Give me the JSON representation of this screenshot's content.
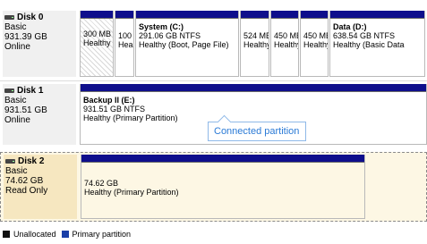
{
  "disks": [
    {
      "name": "Disk 0",
      "type": "Basic",
      "size": "931.39 GB",
      "status": "Online",
      "partitions": [
        {
          "title": "",
          "line1": "300 MB",
          "line2": "Healthy"
        },
        {
          "title": "",
          "line1": "100 MB",
          "line2": "Healthy"
        },
        {
          "title": "System  (C:)",
          "line1": "291.06 GB NTFS",
          "line2": "Healthy (Boot, Page File)"
        },
        {
          "title": "",
          "line1": "524 MB",
          "line2": "Healthy"
        },
        {
          "title": "",
          "line1": "450 MB",
          "line2": "Healthy"
        },
        {
          "title": "",
          "line1": "450 MB",
          "line2": "Healthy"
        },
        {
          "title": "Data  (D:)",
          "line1": "638.54 GB NTFS",
          "line2": "Healthy (Basic Data"
        }
      ]
    },
    {
      "name": "Disk 1",
      "type": "Basic",
      "size": "931.51 GB",
      "status": "Online",
      "partitions": [
        {
          "title": "Backup II  (E:)",
          "line1": "931.51 GB NTFS",
          "line2": "Healthy (Primary Partition)"
        }
      ]
    },
    {
      "name": "Disk 2",
      "type": "Basic",
      "size": "74.62 GB",
      "status": "Read Only",
      "partitions": [
        {
          "title": "",
          "line1": "74.62 GB",
          "line2": "Healthy (Primary Partition)"
        }
      ]
    }
  ],
  "tooltip": "Connected partition",
  "legend": [
    {
      "label": "Unallocated",
      "color": "#111111"
    },
    {
      "label": "Primary partition",
      "color": "#1a3fa8"
    }
  ]
}
